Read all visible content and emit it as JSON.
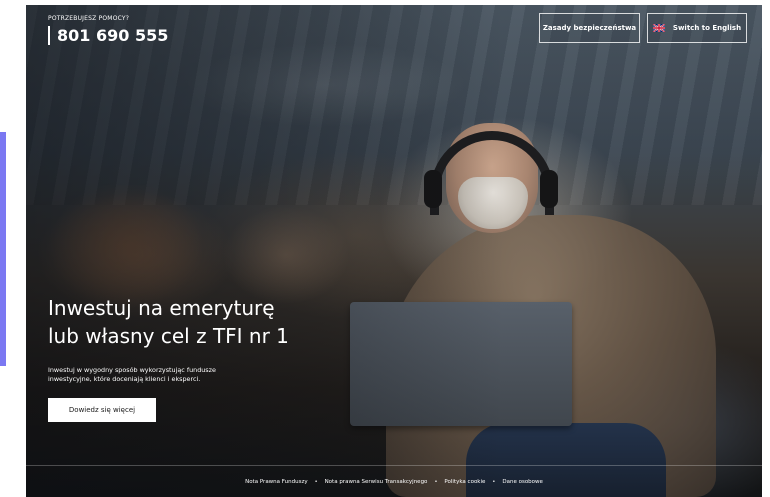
{
  "header": {
    "help_label": "POTRZEBUJESZ POMOCY?",
    "phone": "801 690 555",
    "security_button": "Zasady bezpieczeństwa",
    "english_button": "Switch to English"
  },
  "hero": {
    "title_line1": "Inwestuj na emeryturę",
    "title_line2": "lub własny cel z TFI nr 1",
    "subtitle_line1": "Inwestuj w wygodny sposób wykorzystując fundusze",
    "subtitle_line2": "inwestycyjne, które doceniają klienci i eksperci.",
    "cta_label": "Dowiedz się więcej"
  },
  "footer": {
    "links": [
      "Nota Prawna Funduszy",
      "Nota prawna Serwisu Transakcyjnego",
      "Polityka cookie",
      "Dane osobowe"
    ],
    "separator": "•"
  },
  "colors": {
    "accent_bar": "#7b78f2",
    "text": "#ffffff",
    "cta_background": "#ffffff"
  },
  "icons": {
    "english_button": "uk-flag-icon"
  }
}
